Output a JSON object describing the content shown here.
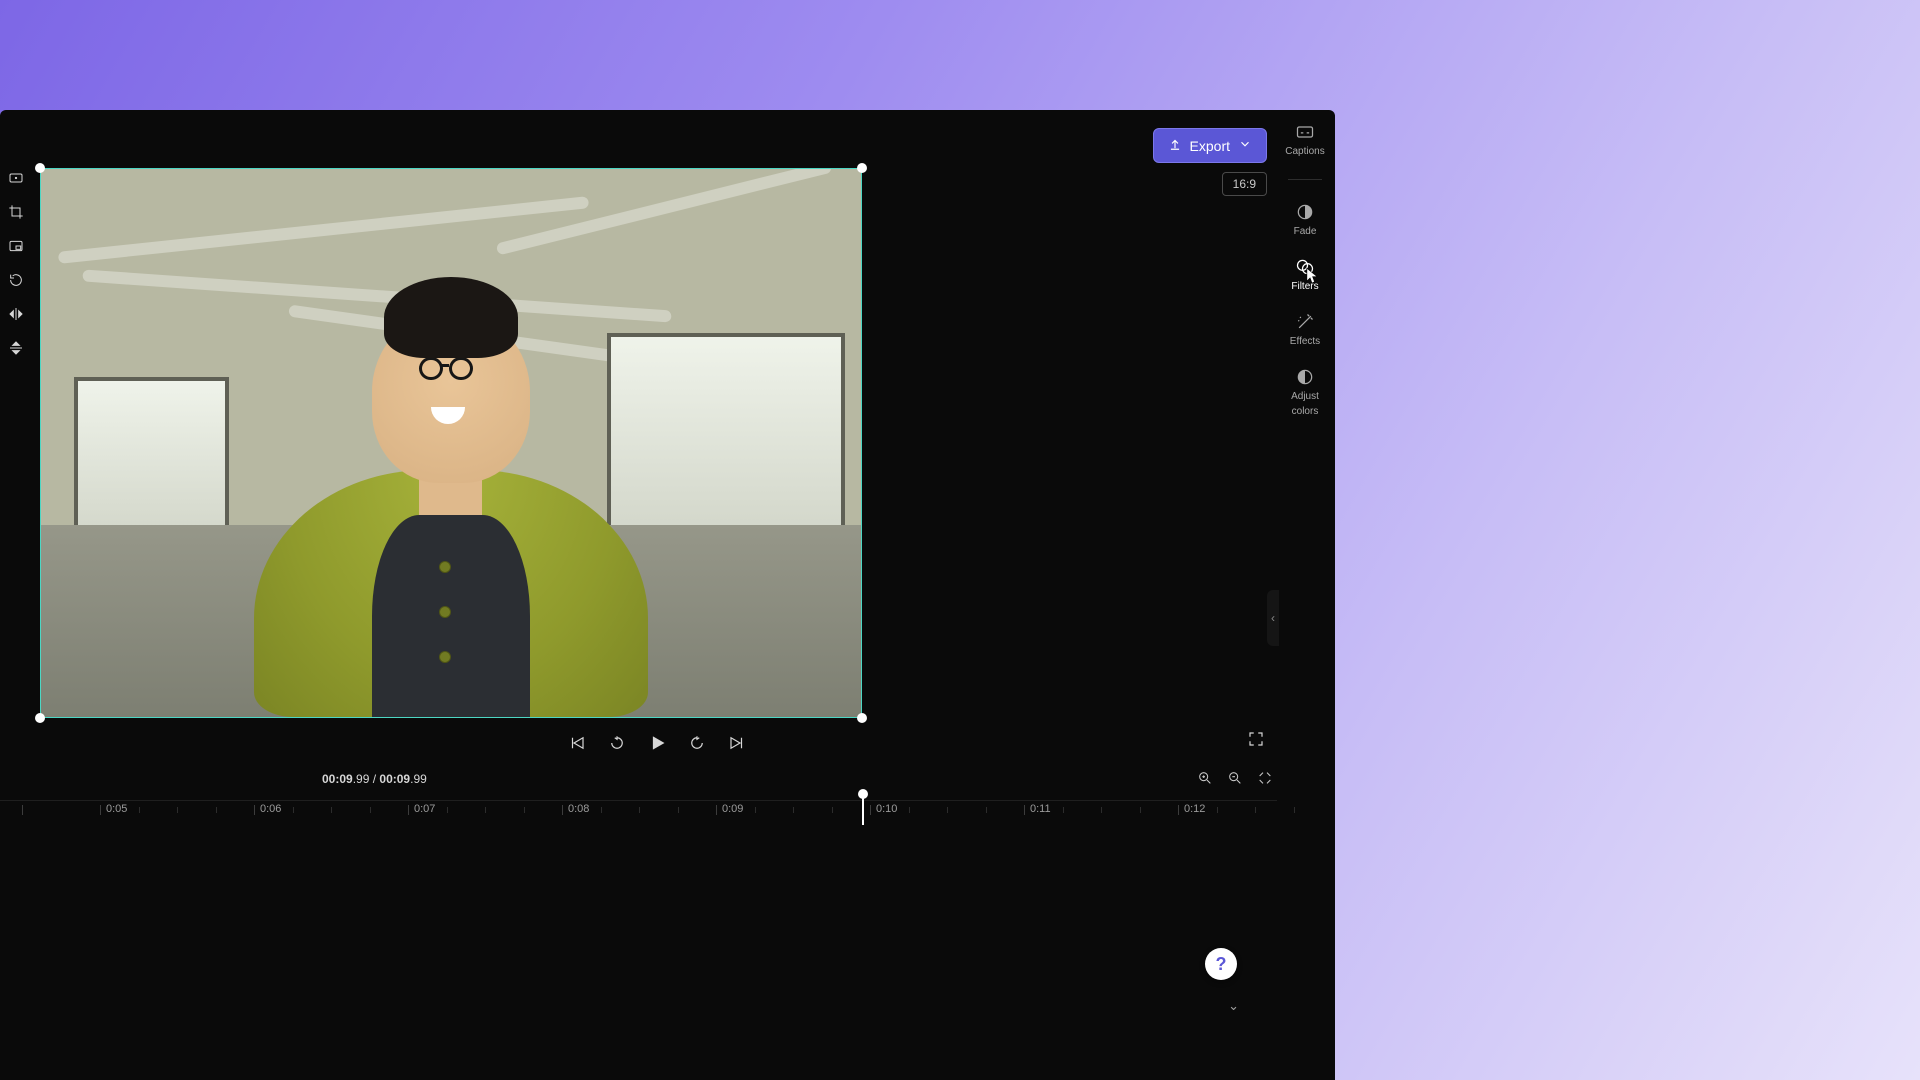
{
  "header": {
    "export_label": "Export",
    "aspect_ratio": "16:9"
  },
  "right_panel": {
    "captions": "Captions",
    "fade": "Fade",
    "filters": "Filters",
    "effects": "Effects",
    "adjust_colors_line1": "Adjust",
    "adjust_colors_line2": "colors"
  },
  "left_tools": {
    "fit": "fit",
    "crop": "crop",
    "pip": "pip",
    "rotate": "rotate",
    "flip_h": "flip-horizontal",
    "flip_v": "flip-vertical"
  },
  "playback": {
    "current": "00:09",
    "current_frac": ".99",
    "sep": " / ",
    "total": "00:09",
    "total_frac": ".99"
  },
  "timeline": {
    "labels": [
      "0:05",
      "0:06",
      "0:07",
      "0:08",
      "0:09",
      "0:10",
      "0:11",
      "0:12"
    ],
    "playhead_label": "0:10"
  },
  "help": {
    "symbol": "?"
  }
}
